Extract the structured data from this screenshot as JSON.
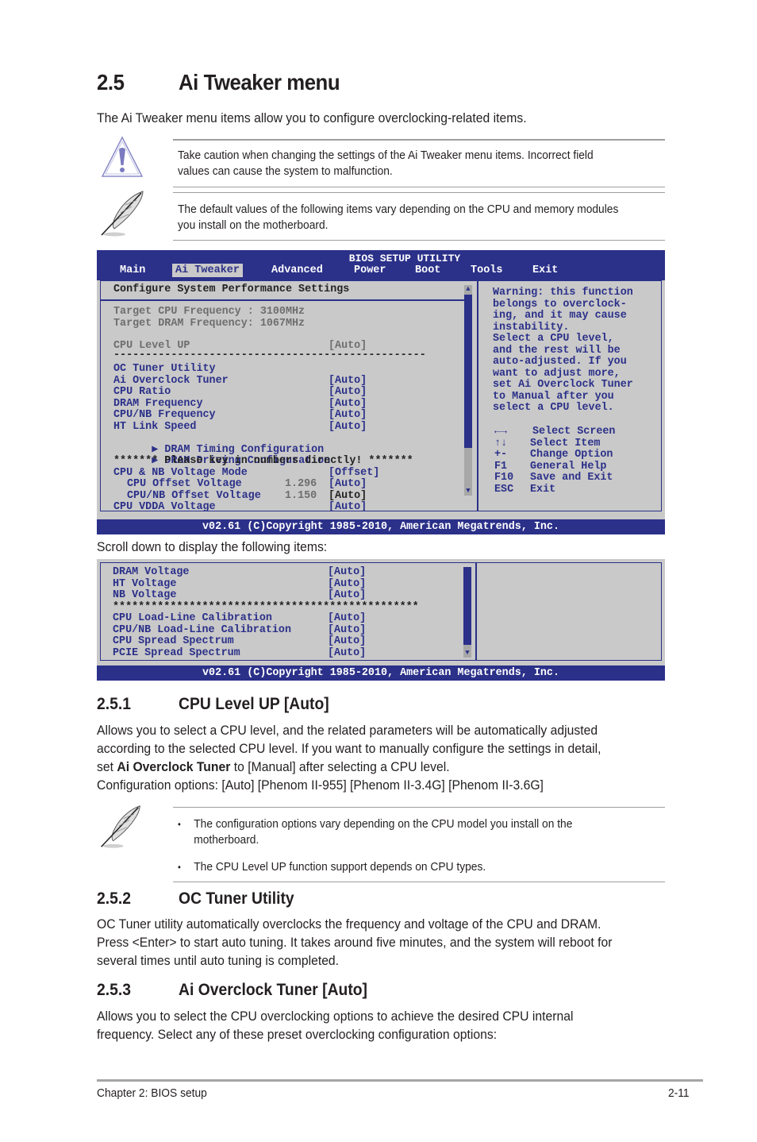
{
  "section": {
    "number": "2.5",
    "title": "Ai Tweaker menu",
    "intro": "The Ai Tweaker menu items allow you to configure overclocking-related items."
  },
  "notes": {
    "caution_icon": "warning-triangle-icon",
    "caution_text": [
      "Take caution when changing the settings of the Ai Tweaker menu items. Incorrect field",
      "values can cause the system to malfunction."
    ],
    "note_icon": "feather-pen-icon",
    "note_text": [
      "The default values of the following items vary depending on the CPU and memory modules",
      "you install on the motherboard."
    ]
  },
  "bios": {
    "title": "BIOS SETUP UTILITY",
    "tabs": [
      "Main",
      "Ai Tweaker",
      "Advanced",
      "Power",
      "Boot",
      "Tools",
      "Exit"
    ],
    "active_tab": "Ai Tweaker",
    "panel_heading": "Configure System Performance Settings",
    "target_cpu": "Target CPU Frequency : 3100MHz",
    "target_dram": "Target DRAM Frequency: 1067MHz",
    "cpu_level_up": {
      "label": "CPU Level UP",
      "value": "[Auto]"
    },
    "separator": "-------------------------------------------------",
    "oc_tuner": "OC Tuner Utility",
    "items": [
      {
        "label": "Ai Overclock Tuner",
        "value": "[Auto]"
      },
      {
        "label": "CPU Ratio",
        "value": "[Auto]"
      },
      {
        "label": "DRAM Frequency",
        "value": "[Auto]"
      },
      {
        "label": "CPU/NB Frequency",
        "value": "[Auto]"
      },
      {
        "label": "HT Link Speed",
        "value": "[Auto]"
      }
    ],
    "submenus": [
      "DRAM Timing Configuration",
      "DRAM Driving Configuration"
    ],
    "key_in_notice": "******* Please key in numbers directly! *******",
    "voltage_mode": {
      "label": "CPU & NB Voltage Mode",
      "value": "[Offset]"
    },
    "offset_items": [
      {
        "label": "CPU Offset Voltage",
        "reading": "1.296",
        "value": "[Auto]"
      },
      {
        "label": "CPU/NB Offset Voltage",
        "reading": "1.150",
        "value": "[Auto]"
      }
    ],
    "vdda": {
      "label": "CPU VDDA Voltage",
      "value": "[Auto]"
    },
    "help_text": [
      "Warning: this function",
      "belongs to overclock-",
      "ing, and it may cause",
      "instability.",
      "Select a CPU level,",
      "and the rest will be",
      "auto-adjusted. If you",
      "want to adjust more,",
      "set Ai Overclock Tuner",
      "to Manual after you",
      "select a CPU level."
    ],
    "keys": [
      {
        "key": "←→",
        "action": "Select Screen"
      },
      {
        "key": "↑↓",
        "action": "Select Item"
      },
      {
        "key": "+-",
        "action": "Change Option"
      },
      {
        "key": "F1",
        "action": "General Help"
      },
      {
        "key": "F10",
        "action": "Save and Exit"
      },
      {
        "key": "ESC",
        "action": "Exit"
      }
    ],
    "footer": "v02.61 (C)Copyright 1985-2010, American Megatrends, Inc."
  },
  "scroll_caption": "Scroll down to display the following items:",
  "bios2": {
    "items_a": [
      {
        "label": "DRAM Voltage",
        "value": "[Auto]"
      },
      {
        "label": "HT Voltage",
        "value": "[Auto]"
      },
      {
        "label": "NB Voltage",
        "value": "[Auto]"
      }
    ],
    "stars": "************************************************",
    "items_b": [
      {
        "label": "CPU Load-Line Calibration",
        "value": "[Auto]"
      },
      {
        "label": "CPU/NB Load-Line Calibration",
        "value": "[Auto]"
      },
      {
        "label": "CPU Spread Spectrum",
        "value": "[Auto]"
      },
      {
        "label": "PCIE Spread Spectrum",
        "value": "[Auto]"
      }
    ],
    "footer": "v02.61 (C)Copyright 1985-2010, American Megatrends, Inc."
  },
  "s251": {
    "number": "2.5.1",
    "title": "CPU Level UP [Auto]",
    "lines": [
      "Allows you to select a CPU level, and the related parameters will be automatically adjusted",
      "according to the selected CPU level. If you want to manually configure the settings in detail,"
    ],
    "line3_pre": "set ",
    "line3_bold": "Ai Overclock Tuner",
    "line3_post": " to [Manual] after selecting a CPU level.",
    "options": "Configuration options: [Auto] [Phenom II-955] [Phenom II-3.4G] [Phenom II-3.6G]",
    "note_bullets": [
      [
        "The configuration options vary depending on the CPU model you install on the",
        "motherboard."
      ],
      [
        "The CPU Level UP function support depends on CPU types."
      ]
    ]
  },
  "s252": {
    "number": "2.5.2",
    "title": "OC Tuner Utility",
    "lines": [
      "OC Tuner utility automatically overclocks the frequency and voltage of the CPU and DRAM.",
      "Press <Enter> to start auto tuning. It takes around five minutes, and the system will reboot for",
      "several times until auto tuning is completed."
    ]
  },
  "s253": {
    "number": "2.5.3",
    "title": "Ai Overclock Tuner [Auto]",
    "lines": [
      "Allows you to select the CPU overclocking options to achieve the desired CPU internal",
      "frequency. Select any of these preset overclocking configuration options:"
    ]
  },
  "footer": {
    "chapter": "Chapter 2: BIOS setup",
    "page": "2-11"
  }
}
